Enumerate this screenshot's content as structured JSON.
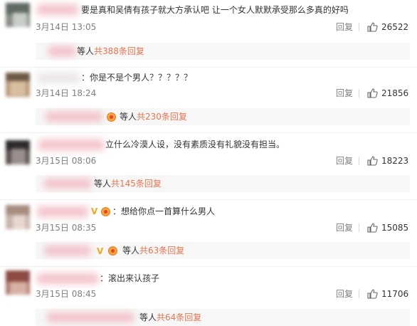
{
  "comments": [
    {
      "text": "要是真和吴倩有孩子就大方承认吧 让一个女人默默承受那么多真的好吗",
      "date": "3月14日 13:05",
      "reply_label": "回复",
      "likes": "26522",
      "sub": {
        "deng": "等人",
        "link": "共388条回复"
      }
    },
    {
      "text": "：你是不是个男人？？？？？",
      "date": "3月14日 18:24",
      "reply_label": "回复",
      "likes": "21856",
      "sub": {
        "deng": "等人",
        "link": "共230条回复"
      }
    },
    {
      "text": "立什么冷漠人设，没有素质没有礼貌没有担当。",
      "date": "3月15日 08:06",
      "reply_label": "回复",
      "likes": "18223",
      "sub": {
        "deng": "等人",
        "link": "共145条回复"
      }
    },
    {
      "text": "：想给你点一首算什么男人",
      "date": "3月15日 08:35",
      "reply_label": "回复",
      "likes": "15085",
      "sub": {
        "deng": "等人",
        "link": "共63条回复"
      }
    },
    {
      "text": "：滚出来认孩子",
      "date": "3月15日 08:45",
      "reply_label": "回复",
      "likes": "11706",
      "sub": {
        "deng": "等人",
        "link": "共64条回复"
      }
    }
  ],
  "badges": {
    "vip_letter": "V"
  },
  "colors": {
    "link": "#eb7350",
    "meta": "#808080",
    "sub_bg": "#f7f7f7"
  },
  "icons": {
    "like": "thumbs-up-icon",
    "member": "crown-icon",
    "verified": "vip-v-icon"
  }
}
